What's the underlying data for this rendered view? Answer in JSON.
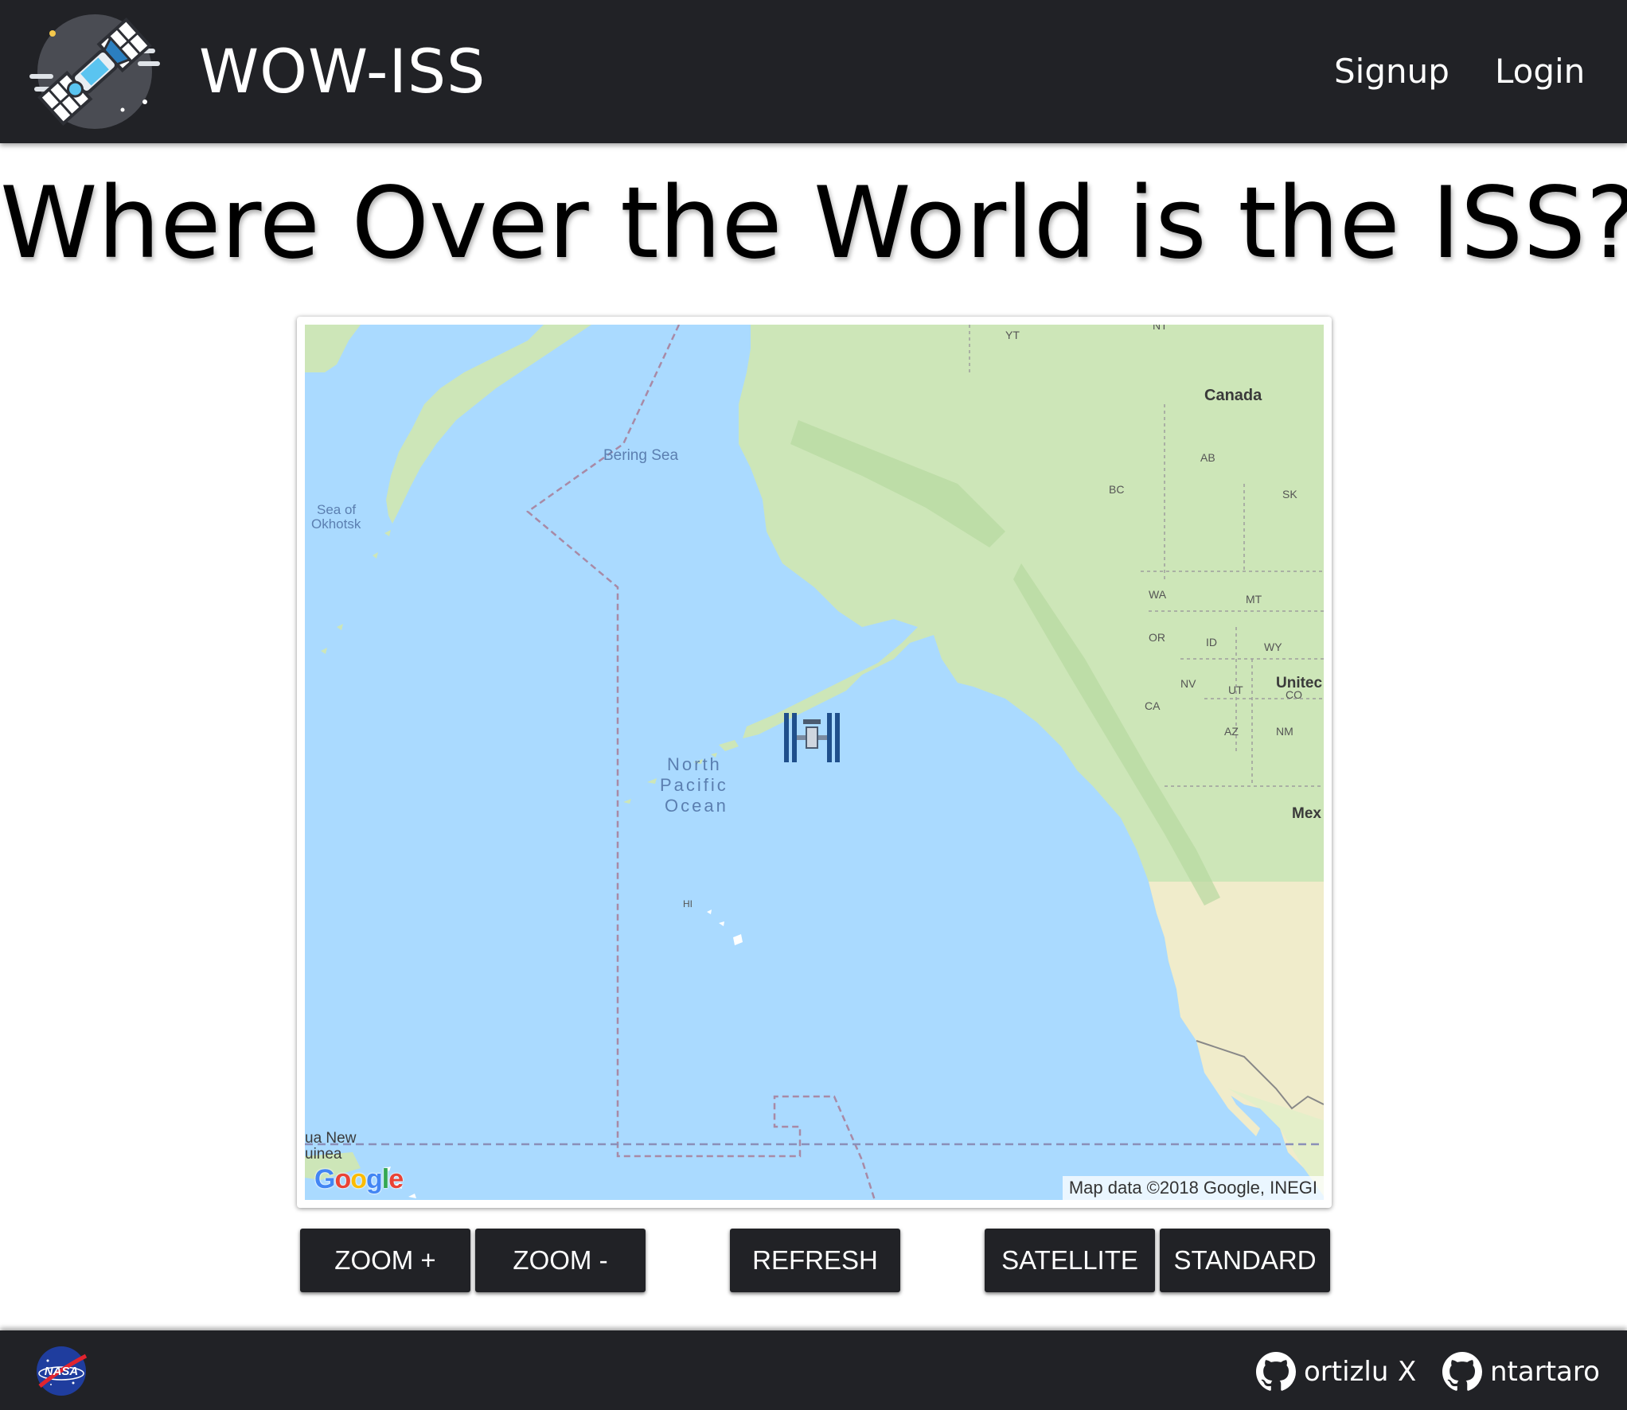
{
  "navbar": {
    "brand_title": "WOW-ISS",
    "signup_label": "Signup",
    "login_label": "Login"
  },
  "headline": "Where Over the World is the ISS?",
  "map": {
    "labels": {
      "bering_sea": "Bering Sea",
      "sea_of_okhotsk_1": "Sea of",
      "sea_of_okhotsk_2": "Okhotsk",
      "north": "North",
      "pacific": "Pacific",
      "ocean": "Ocean",
      "canada": "Canada",
      "yt": "YT",
      "nt": "NT",
      "ab": "AB",
      "bc": "BC",
      "sk": "SK",
      "wa": "WA",
      "mt": "MT",
      "or": "OR",
      "id": "ID",
      "wy": "WY",
      "nv": "NV",
      "ut": "UT",
      "co": "CO",
      "united": "Unitec",
      "ca": "CA",
      "az": "AZ",
      "nm": "NM",
      "mex": "Mex",
      "hi": "HI",
      "png_1": "ua New",
      "png_2": "uinea"
    },
    "attribution": "Map data ©2018 Google, INEGI",
    "google_logo": [
      "G",
      "o",
      "o",
      "g",
      "l",
      "e"
    ],
    "colors": {
      "water": "#aadaff",
      "land": "#cde6b8",
      "land_dry": "#f0eccb",
      "boundary": "#a88aa6"
    }
  },
  "controls": {
    "zoom_in_label": "ZOOM +",
    "zoom_out_label": "ZOOM -",
    "refresh_label": "REFRESH",
    "satellite_label": "SATELLITE",
    "standard_label": "STANDARD"
  },
  "footer": {
    "logo_text": "NASA",
    "author_1": "ortizlu",
    "separator": "X",
    "author_2": "ntartaro"
  },
  "icons": {
    "brand": "satellite-icon",
    "iss": "iss-marker-icon",
    "nasa": "nasa-logo-icon",
    "github": "github-icon"
  },
  "theme": {
    "bar_color": "#212226",
    "text_color": "#000000"
  }
}
